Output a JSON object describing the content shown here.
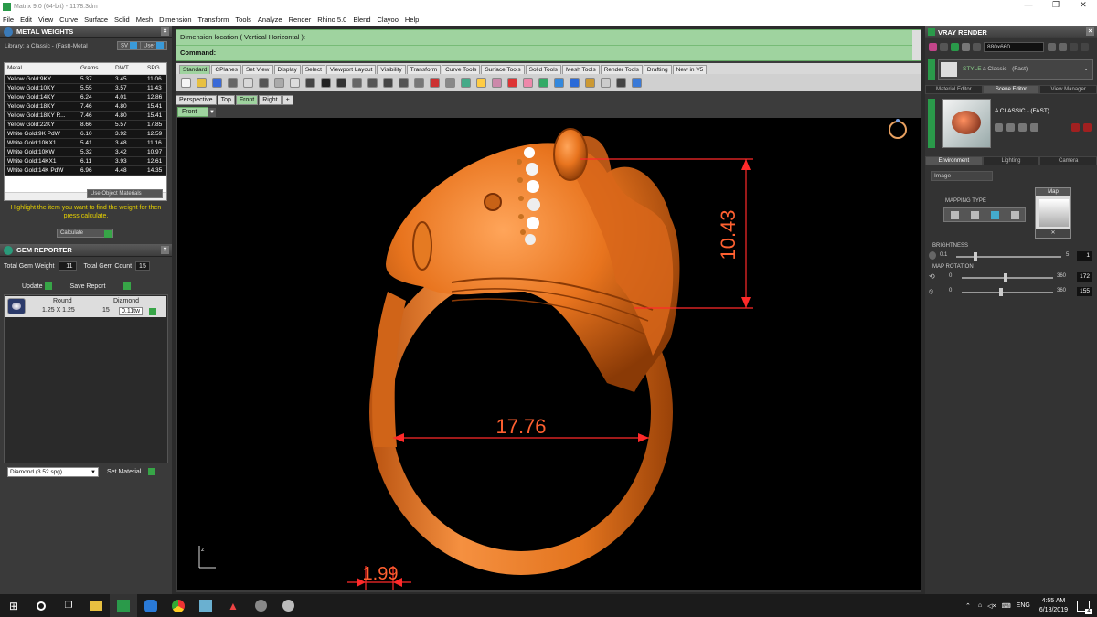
{
  "window": {
    "title": "Matrix 9.0 (64-bit) - 1178.3dm",
    "controls": [
      "—",
      "❐",
      "✕"
    ]
  },
  "menu": [
    "File",
    "Edit",
    "View",
    "Curve",
    "Surface",
    "Solid",
    "Mesh",
    "Dimension",
    "Transform",
    "Tools",
    "Analyze",
    "Render",
    "Rhino 5.0",
    "Blend",
    "Clayoo",
    "Help"
  ],
  "metal_weights": {
    "title": "METAL WEIGHTS",
    "library": "Library: a Classic - (Fast)-Metal",
    "btn_sv": "SV",
    "btn_user": "User",
    "columns": [
      "Metal",
      "Grams",
      "DWT",
      "SPG"
    ],
    "rows": [
      [
        "Yellow Gold:9KY",
        "5.37",
        "3.45",
        "11.06"
      ],
      [
        "Yellow Gold:10KY",
        "5.55",
        "3.57",
        "11.43"
      ],
      [
        "Yellow Gold:14KY",
        "6.24",
        "4.01",
        "12.86"
      ],
      [
        "Yellow Gold:18KY",
        "7.46",
        "4.80",
        "15.41"
      ],
      [
        "Yellow Gold:18KY R...",
        "7.46",
        "4.80",
        "15.41"
      ],
      [
        "Yellow Gold:22KY",
        "8.66",
        "5.57",
        "17.85"
      ],
      [
        "White Gold:9K PdW",
        "6.10",
        "3.92",
        "12.59"
      ],
      [
        "White Gold:10KX1",
        "5.41",
        "3.48",
        "11.16"
      ],
      [
        "White Gold:10KW",
        "5.32",
        "3.42",
        "10.97"
      ],
      [
        "White Gold:14KX1",
        "6.11",
        "3.93",
        "12.61"
      ],
      [
        "White Gold:14K PdW",
        "6.96",
        "4.48",
        "14.35"
      ]
    ],
    "use_object": "Use Object Materials",
    "hint": "Highlight the item you want to find the weight for then press calculate.",
    "calculate": "Calculate"
  },
  "gem_reporter": {
    "title": "GEM REPORTER",
    "total_weight_label": "Total Gem Weight",
    "total_weight": "11",
    "total_count_label": "Total Gem Count",
    "total_count": "15",
    "update": "Update",
    "save_report": "Save Report",
    "item": {
      "shape": "Round",
      "type": "Diamond",
      "size": "1.25 X 1.25",
      "count": "15",
      "weight": "0.11tw"
    },
    "material_select": "Diamond     (3.52 spg)",
    "set_material": "Set Material"
  },
  "command": {
    "prompt": "Dimension location ( Vertical  Horizontal ):",
    "label": "Command:"
  },
  "tool_tabs": [
    "Standard",
    "CPlanes",
    "Set View",
    "Display",
    "Select",
    "Viewport Layout",
    "Visibility",
    "Transform",
    "Curve Tools",
    "Surface Tools",
    "Solid Tools",
    "Mesh Tools",
    "Render Tools",
    "Drafting",
    "New in V5"
  ],
  "toolbar_icons": [
    "new-icon",
    "open-icon",
    "save-icon",
    "print-icon",
    "import-icon",
    "cut-icon",
    "copy-icon",
    "paste-icon",
    "undo-icon",
    "pan-icon",
    "rotate-icon",
    "zoom-icon",
    "zoom-window-icon",
    "zoom-extents-icon",
    "zoom-selected-icon",
    "grid-icon",
    "car-icon",
    "point-icon",
    "cplane-icon",
    "lightbulb-icon",
    "lock-icon",
    "shaded-icon",
    "color-wheel-icon",
    "sphere-icon",
    "render-sphere-icon",
    "globe-icon",
    "tools-icon",
    "gear-icon",
    "select-icon",
    "help-icon"
  ],
  "viewport_tabs": [
    "Perspective",
    "Top",
    "Front",
    "Right",
    "+"
  ],
  "active_viewport": "Front",
  "dimensions": {
    "height": "10.43",
    "width": "17.76",
    "thickness": "1.99"
  },
  "axis": {
    "z": "z"
  },
  "vray": {
    "title": "VRAY RENDER",
    "resolution": "880x660",
    "style_label": "STYLE",
    "style_value": "a Classic - (Fast)",
    "tabs": [
      "Material Editor",
      "Scene Editor",
      "View Manager"
    ],
    "scene_name": "A CLASSIC - (FAST)",
    "subtabs": [
      "Environment",
      "Lighting",
      "Camera"
    ],
    "env_type": "Image",
    "mapping_type": "MAPPING TYPE",
    "map_label": "Map",
    "brightness_label": "BRIGHTNESS",
    "brightness_min": "0.1",
    "brightness_max": "5",
    "brightness_value": "1",
    "map_rotation_label": "MAP ROTATION",
    "rot1_min": "0",
    "rot1_max": "360",
    "rot1_value": "172",
    "rot2_min": "0",
    "rot2_max": "360",
    "rot2_value": "155"
  },
  "taskbar": {
    "lang": "ENG",
    "time": "4:55 AM",
    "date": "6/18/2019",
    "notifications": "4"
  }
}
